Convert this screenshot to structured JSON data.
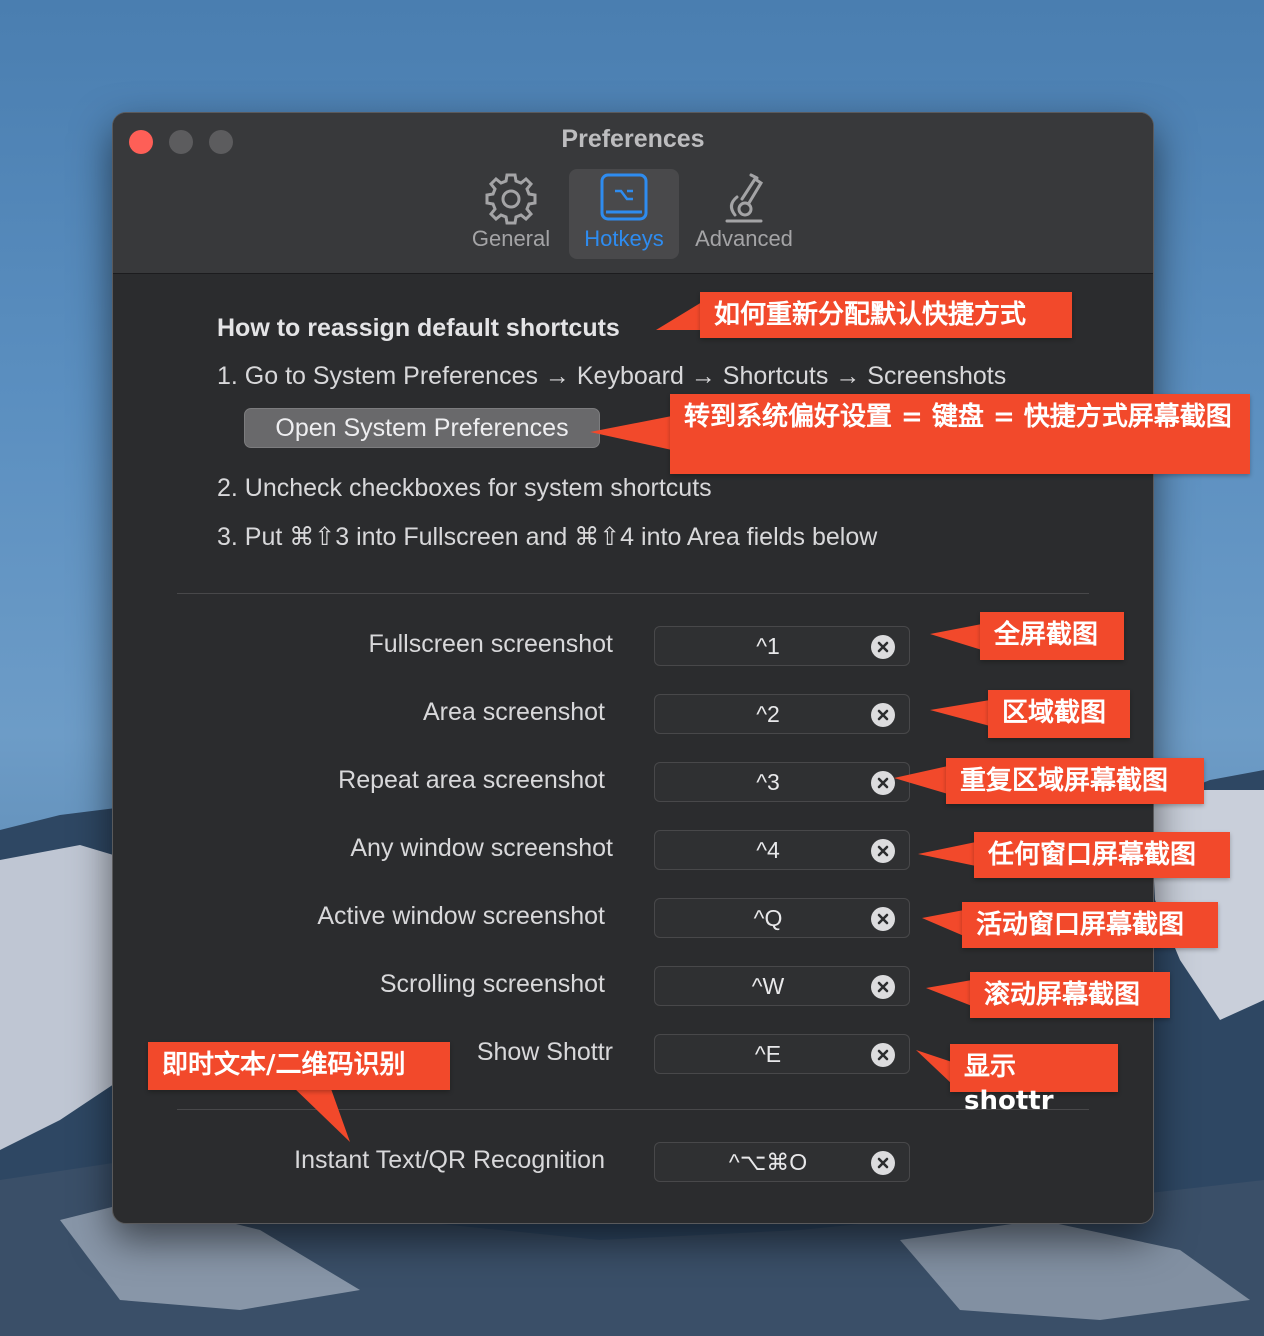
{
  "window": {
    "title": "Preferences",
    "controls": [
      "close",
      "minimize",
      "zoom"
    ]
  },
  "tabs": [
    {
      "label": "General",
      "icon": "gear-icon",
      "active": false
    },
    {
      "label": "Hotkeys",
      "icon": "keyboard-icon",
      "active": true
    },
    {
      "label": "Advanced",
      "icon": "microscope-icon",
      "active": false
    }
  ],
  "instructions": {
    "heading": "How to reassign default shortcuts",
    "step1": "1. Go to System Preferences → Keyboard → Shortcuts → Screenshots",
    "open_button": "Open System Preferences",
    "step2": "2. Uncheck checkboxes for system shortcuts",
    "step3": "3. Put ⌘⇧3 into Fullscreen and ⌘⇧4 into Area fields below"
  },
  "hotkeys": [
    {
      "label": "Fullscreen screenshot",
      "value": "^1"
    },
    {
      "label": "Area screenshot",
      "value": "^2"
    },
    {
      "label": "Repeat area screenshot",
      "value": "^3"
    },
    {
      "label": "Any window screenshot",
      "value": "^4"
    },
    {
      "label": "Active window screenshot",
      "value": "^Q"
    },
    {
      "label": "Scrolling screenshot",
      "value": "^W"
    },
    {
      "label": "Show Shottr",
      "value": "^E"
    },
    {
      "label": "Instant Text/QR Recognition",
      "value": "^⌥⌘O"
    }
  ],
  "annotations": {
    "heading_cn": "如何重新分配默认快捷方式",
    "step1_cn": "转到系统偏好设置 = 键盘 = 快捷方式屏幕截图",
    "fullscreen_cn": "全屏截图",
    "area_cn": "区域截图",
    "repeat_area_cn": "重复区域屏幕截图",
    "any_window_cn": "任何窗口屏幕截图",
    "active_window_cn": "活动窗口屏幕截图",
    "scrolling_cn": "滚动屏幕截图",
    "show_shottr_cn": "显示 shottr",
    "instant_text_cn": "即时文本/二维码识别"
  },
  "colors": {
    "accent": "#2e8cf0",
    "annotation": "#f2492b",
    "window_bg": "#2b2c2e",
    "toolbar_bg": "#38393b",
    "close": "#fe5f57"
  }
}
